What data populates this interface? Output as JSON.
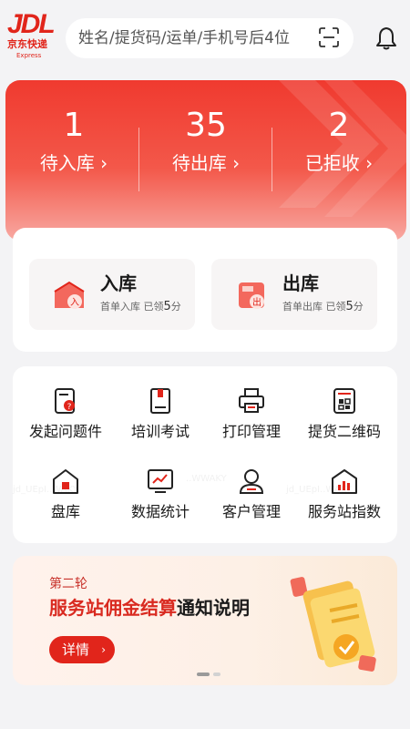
{
  "header": {
    "logo_main": "JDL",
    "logo_cn": "京东快递",
    "logo_en": "Express",
    "search_placeholder": "姓名/提货码/运单/手机号后4位",
    "icons": [
      "scan-icon",
      "bell-icon"
    ]
  },
  "stats": [
    {
      "value": "1",
      "label": "待入库 ›"
    },
    {
      "value": "35",
      "label": "待出库 ›"
    },
    {
      "value": "2",
      "label": "已拒收 ›"
    }
  ],
  "io": [
    {
      "title": "入库",
      "sub_prefix": "首单入库 已领",
      "points": "5",
      "sub_suffix": "分",
      "icon": "inbound-icon",
      "badge": "入"
    },
    {
      "title": "出库",
      "sub_prefix": "首单出库 已领",
      "points": "5",
      "sub_suffix": "分",
      "icon": "outbound-icon",
      "badge": "出"
    }
  ],
  "grid": [
    {
      "label": "发起问题件",
      "icon": "issue-report-icon"
    },
    {
      "label": "培训考试",
      "icon": "training-book-icon"
    },
    {
      "label": "打印管理",
      "icon": "printer-icon"
    },
    {
      "label": "提货二维码",
      "icon": "qr-code-icon"
    },
    {
      "label": "盘库",
      "icon": "inventory-house-icon"
    },
    {
      "label": "数据统计",
      "icon": "statistics-chart-icon"
    },
    {
      "label": "客户管理",
      "icon": "customer-icon"
    },
    {
      "label": "服务站指数",
      "icon": "station-index-icon"
    }
  ],
  "banner": {
    "subtitle": "第二轮",
    "title_part1": "服务站",
    "title_part2": "佣金结算",
    "title_part3": "通知说明",
    "button": "详情",
    "button_arrow": "›",
    "active_slide": 1,
    "slide_count": 2
  },
  "colors": {
    "brand_red": "#e1251b",
    "background": "#f3f3f5"
  }
}
